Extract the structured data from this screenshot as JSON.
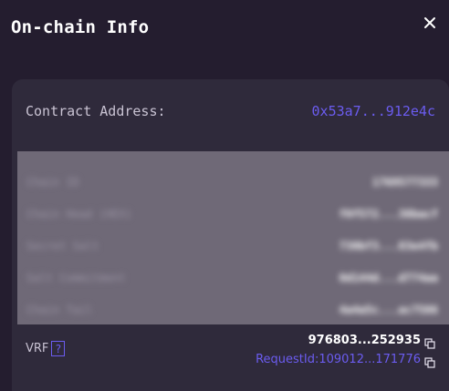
{
  "modal": {
    "title": "On-chain Info"
  },
  "contract": {
    "label": "Contract Address:",
    "value": "0x53a7...912e4c"
  },
  "hidden_rows": [
    {
      "label": "Chain ID",
      "value": "1769577333"
    },
    {
      "label": "Chain Head (HEX)",
      "value": "f0f572...38bacf"
    },
    {
      "label": "Secret Salt",
      "value": "730bf3...83e4fb"
    },
    {
      "label": "Salt Commitment",
      "value": "0d144d...d774aa"
    },
    {
      "label": "Chain Tail",
      "value": "4a4a5c...ac7586"
    }
  ],
  "vrf": {
    "label": "VRF",
    "help": "?",
    "value": "976803...252935",
    "request_id": "RequestId:109012...171776"
  },
  "colors": {
    "accent": "#6b5cf0",
    "background": "#241d2f",
    "card": "#2f2a3b"
  }
}
